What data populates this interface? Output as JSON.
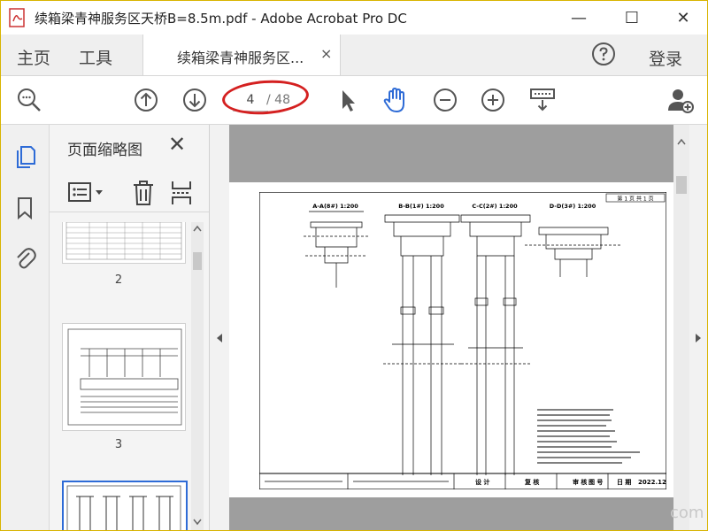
{
  "window": {
    "title": "续箱梁青神服务区天桥B=8.5m.pdf - Adobe Acrobat Pro DC",
    "minimize_glyph": "—",
    "maximize_glyph": "☐",
    "close_glyph": "✕"
  },
  "tabs": {
    "home": "主页",
    "tools": "工具",
    "document": "续箱梁青神服务区...",
    "document_close": "×",
    "login": "登录"
  },
  "toolbar": {
    "current_page": "4",
    "total_pages": "/ 48",
    "accent": "#2e6bd6",
    "annotation": "#d42020"
  },
  "thumbnails_panel": {
    "title": "页面缩略图",
    "close": "✕",
    "pages": [
      {
        "label": "2"
      },
      {
        "label": "3"
      }
    ]
  },
  "drawing": {
    "sections": [
      {
        "title": "A-A(8#) 1:200"
      },
      {
        "title": "B-B(1#) 1:200"
      },
      {
        "title": "C-C(2#) 1:200"
      },
      {
        "title": "D-D(3#) 1:200"
      }
    ],
    "sheet_label": "第 1 页 共 1 页",
    "title_block": {
      "designer_col": "设 计",
      "checker_col": "复 核",
      "reviewer_col": "审 核",
      "drawing_no": "图 号",
      "date_label": "日 期",
      "date_value": "2022.12"
    }
  },
  "watermark": "com"
}
